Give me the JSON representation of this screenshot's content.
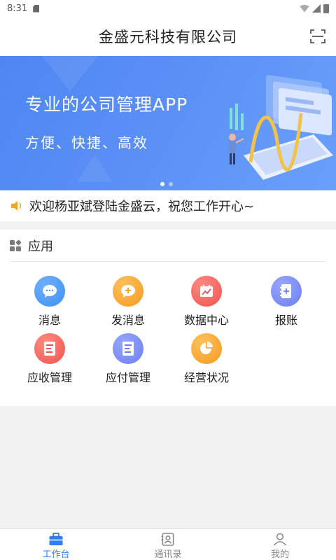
{
  "status_bar": {
    "time": "8:31"
  },
  "header": {
    "title": "金盛元科技有限公司"
  },
  "banner": {
    "title": "专业的公司管理APP",
    "subtitle": "方便、快捷、高效",
    "dots": 2,
    "active_dot": 0
  },
  "notice": {
    "text": "欢迎杨亚斌登陆金盛云，祝您工作开心~"
  },
  "apps": {
    "title": "应用",
    "items": [
      {
        "label": "消息",
        "icon": "chat-bubble-icon",
        "color": "#3d8ff5"
      },
      {
        "label": "发消息",
        "icon": "send-message-icon",
        "color": "#f59a1f"
      },
      {
        "label": "数据中心",
        "icon": "data-center-icon",
        "color": "#ef5350"
      },
      {
        "label": "报账",
        "icon": "expense-report-icon",
        "color": "#6b7ff0"
      },
      {
        "label": "应收管理",
        "icon": "receivables-icon",
        "color": "#ef5350"
      },
      {
        "label": "应付管理",
        "icon": "payables-icon",
        "color": "#6b7ff0"
      },
      {
        "label": "经营状况",
        "icon": "pie-chart-icon",
        "color": "#f59a1f"
      }
    ]
  },
  "tabbar": {
    "tabs": [
      {
        "label": "工作台",
        "icon": "briefcase-icon",
        "active": true
      },
      {
        "label": "通讯录",
        "icon": "contacts-icon",
        "active": false
      },
      {
        "label": "我的",
        "icon": "user-icon",
        "active": false
      }
    ],
    "active_color": "#2f7ef6"
  }
}
